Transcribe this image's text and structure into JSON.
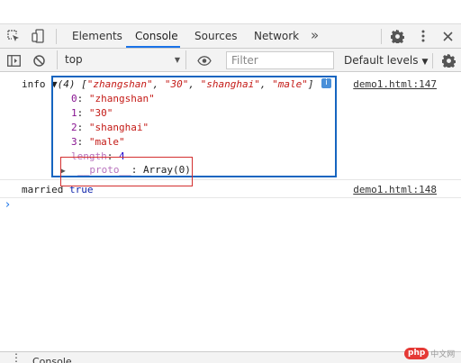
{
  "toolbar": {
    "tabs": [
      "Elements",
      "Console",
      "Sources",
      "Network"
    ],
    "more_label": "»"
  },
  "filterbar": {
    "context": "top",
    "filter_placeholder": "Filter",
    "levels_label": "Default levels"
  },
  "console": {
    "messages": [
      {
        "label": "info",
        "source": "demo1.html:147",
        "summary": {
          "count": "(4)",
          "items": [
            "\"zhangshan\"",
            "\"30\"",
            "\"shanghai\"",
            "\"male\""
          ]
        },
        "entries": [
          {
            "key": "0",
            "value": "\"zhangshan\""
          },
          {
            "key": "1",
            "value": "\"30\""
          },
          {
            "key": "2",
            "value": "\"shanghai\""
          },
          {
            "key": "3",
            "value": "\"male\""
          }
        ],
        "length_key": "length",
        "length_value": "4",
        "proto_key": "__proto__",
        "proto_value": "Array(0)"
      },
      {
        "label": "married",
        "value": "true",
        "source": "demo1.html:148"
      }
    ],
    "prompt_symbol": "›"
  },
  "drawer": {
    "tab_label": "Console"
  },
  "watermark": {
    "badge": "php",
    "text": "中文网"
  },
  "colors": {
    "accent": "#1a73e8",
    "highlight_box": "#1565c0",
    "annotation_box": "#d32f2f",
    "string": "#c41a16",
    "key": "#881391",
    "number": "#1c00cf"
  }
}
